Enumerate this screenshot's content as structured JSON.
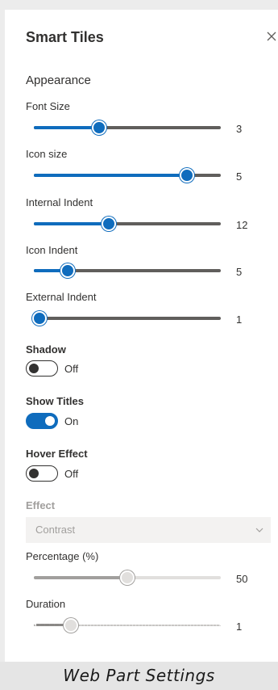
{
  "panel": {
    "title": "Smart Tiles",
    "close_icon": "close-icon",
    "section": "Appearance"
  },
  "sliders": {
    "font_size": {
      "label": "Font Size",
      "value": "3",
      "fraction": 0.35
    },
    "icon_size": {
      "label": "Icon size",
      "value": "5",
      "fraction": 0.82
    },
    "internal_indent": {
      "label": "Internal Indent",
      "value": "12",
      "fraction": 0.4
    },
    "icon_indent": {
      "label": "Icon Indent",
      "value": "5",
      "fraction": 0.18
    },
    "external_indent": {
      "label": "External Indent",
      "value": "1",
      "fraction": 0.03
    },
    "percentage": {
      "label": "Percentage (%)",
      "value": "50",
      "fraction": 0.5
    },
    "duration": {
      "label": "Duration",
      "value": "1",
      "fraction": 0.2
    }
  },
  "toggles": {
    "shadow": {
      "label": "Shadow",
      "state": "Off",
      "on": false
    },
    "show_titles": {
      "label": "Show Titles",
      "state": "On",
      "on": true
    },
    "hover_effect": {
      "label": "Hover Effect",
      "state": "Off",
      "on": false
    }
  },
  "effect": {
    "label": "Effect",
    "selected": "Contrast",
    "chevron_icon": "chevron-down-icon"
  },
  "caption": "Web Part Settings",
  "colors": {
    "accent": "#0f6cbd",
    "disabled": "#a19f9d",
    "text": "#323130"
  }
}
